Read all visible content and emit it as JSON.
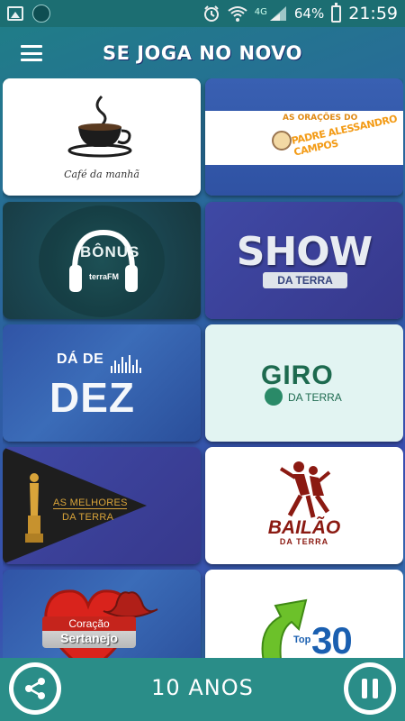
{
  "status_bar": {
    "network": "4G",
    "battery_percent": "64%",
    "time": "21:59"
  },
  "header": {
    "title": "SE JOGA NO NOVO"
  },
  "programs": [
    {
      "id": "cafe",
      "logo_text": "Café da manhã"
    },
    {
      "id": "oracoes",
      "logo_text_top": "AS ORAÇÕES DO",
      "logo_text_main": "PADRE ALESSANDRO CAMPOS"
    },
    {
      "id": "bonus",
      "logo_text_main": "BÔNUS",
      "logo_text_sub": "terraFM"
    },
    {
      "id": "show",
      "logo_text_main": "SHOW",
      "logo_text_sub": "DA TERRA"
    },
    {
      "id": "dadedez",
      "logo_text_top": "DÁ DE",
      "logo_text_main": "DEZ"
    },
    {
      "id": "giro",
      "logo_text_main": "GIRO",
      "logo_text_sub": "DA TERRA"
    },
    {
      "id": "melhores",
      "logo_text_main": "AS MELHORES",
      "logo_text_sub": "DA TERRA"
    },
    {
      "id": "bailao",
      "logo_text_main": "BAILÃO",
      "logo_text_sub": "DA TERRA"
    },
    {
      "id": "coracao",
      "logo_text_top": "Coração",
      "logo_text_main": "Sertanejo"
    },
    {
      "id": "top30",
      "logo_text_top": "Top",
      "logo_text_main": "30"
    }
  ],
  "player": {
    "now_playing": "10 ANOS",
    "share_icon": "share-icon",
    "pause_icon": "pause-icon"
  },
  "colors": {
    "status_bar": "#1c6e72",
    "player_bar": "#2a8d88",
    "accent_orange": "#f39b16",
    "accent_green": "#1d6a4f",
    "accent_red": "#8b1a12",
    "accent_blue": "#1a5fb0"
  }
}
